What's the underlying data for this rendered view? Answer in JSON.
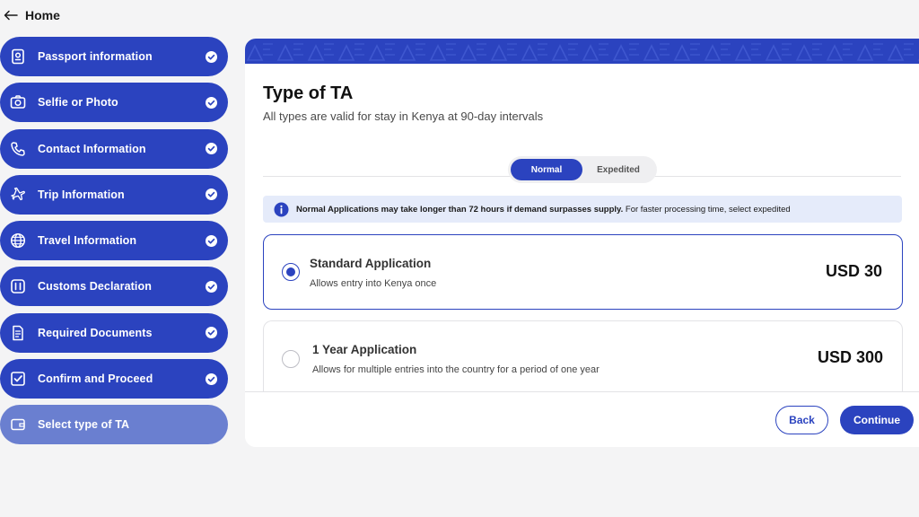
{
  "nav": {
    "home_label": "Home"
  },
  "sidebar": {
    "steps": [
      {
        "label": "Passport information",
        "icon": "passport-icon",
        "completed": true
      },
      {
        "label": "Selfie or Photo",
        "icon": "camera-icon",
        "completed": true
      },
      {
        "label": "Contact Information",
        "icon": "phone-icon",
        "completed": true
      },
      {
        "label": "Trip Information",
        "icon": "plane-icon",
        "completed": true
      },
      {
        "label": "Travel Information",
        "icon": "globe-icon",
        "completed": true
      },
      {
        "label": "Customs Declaration",
        "icon": "customs-icon",
        "completed": true
      },
      {
        "label": "Required Documents",
        "icon": "document-icon",
        "completed": true
      },
      {
        "label": "Confirm and Proceed",
        "icon": "checkbox-icon",
        "completed": true
      },
      {
        "label": "Select type of TA",
        "icon": "wallet-icon",
        "completed": false,
        "current": true
      }
    ]
  },
  "main": {
    "title": "Type of TA",
    "subtitle": "All types are valid for stay in Kenya at 90-day intervals",
    "toggle": {
      "options": [
        "Normal",
        "Expedited"
      ],
      "selected": "Normal"
    },
    "notice": {
      "bold": "Normal Applications may take longer than 72 hours if demand surpasses supply.",
      "rest": " For faster processing time, select expedited"
    },
    "options": [
      {
        "title": "Standard Application",
        "description": "Allows entry into Kenya once",
        "price": "USD 30",
        "selected": true
      },
      {
        "title": "1 Year Application",
        "description": "Allows for multiple entries into the country for a period of one year",
        "price": "USD 300",
        "selected": false
      }
    ],
    "buttons": {
      "back": "Back",
      "continue": "Continue"
    }
  },
  "colors": {
    "primary": "#2b43bf",
    "current_step": "#6a7fd0",
    "notice_bg": "#e5ebfa",
    "page_bg": "#f4f4f5"
  }
}
